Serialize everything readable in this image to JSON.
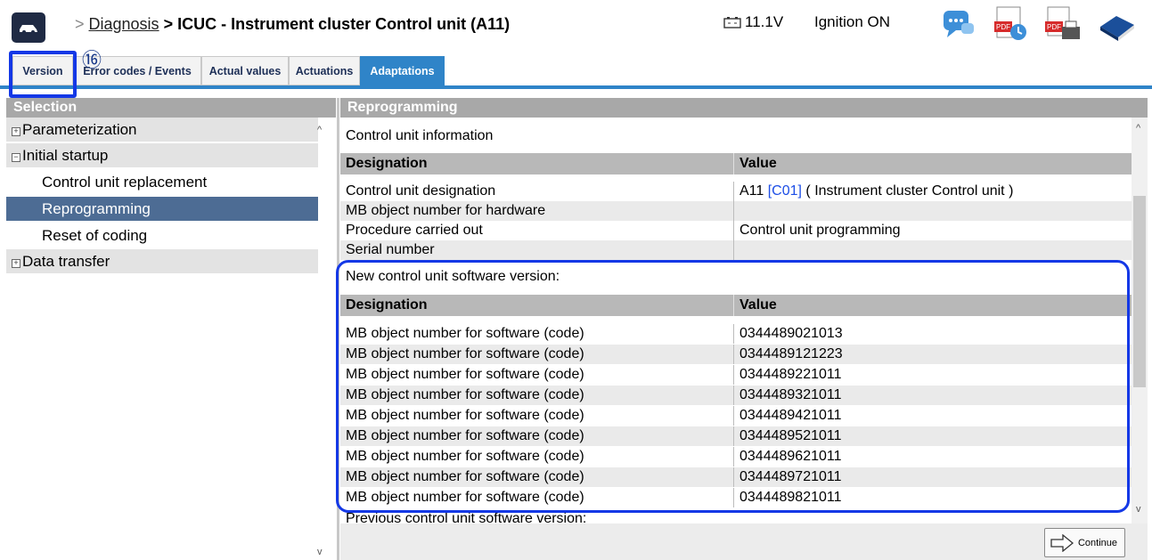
{
  "header": {
    "breadcrumb_sep": ">",
    "breadcrumb_link": "Diagnosis",
    "title": "> ICUC - Instrument cluster Control unit (A11)",
    "voltage": "11.1V",
    "ignition": "Ignition ON",
    "icons": [
      "car-icon",
      "chat-icon",
      "pdf-clock-icon",
      "pdf-print-icon",
      "book-icon"
    ]
  },
  "annotation": {
    "marker": "⑯"
  },
  "tabs": [
    {
      "label": "Version",
      "active": false
    },
    {
      "label": "Error codes / Events",
      "active": false
    },
    {
      "label": "Actual values",
      "active": false
    },
    {
      "label": "Actuations",
      "active": false
    },
    {
      "label": "Adaptations",
      "active": true
    }
  ],
  "left_panel": {
    "header": "Selection",
    "items": [
      {
        "label": "Parameterization",
        "expander": "+"
      },
      {
        "label": "Initial startup",
        "expander": "−"
      },
      {
        "label": "Control unit replacement"
      },
      {
        "label": "Reprogramming",
        "selected": true
      },
      {
        "label": "Reset of coding"
      },
      {
        "label": "Data transfer",
        "expander": "+"
      }
    ]
  },
  "right_panel": {
    "header": "Reprogramming",
    "info_section": "Control unit information",
    "col_designation": "Designation",
    "col_value": "Value",
    "info_rows": [
      {
        "designation": "Control unit designation",
        "value_prefix": "A11 ",
        "value_link": "[C01]",
        "value_suffix": " ( Instrument cluster Control unit )"
      },
      {
        "designation": "MB object number for hardware",
        "value": ""
      },
      {
        "designation": "Procedure carried out",
        "value": "Control unit programming"
      },
      {
        "designation": "Serial number",
        "value": ""
      }
    ],
    "new_section": "New control unit software version:",
    "software_rows": [
      {
        "designation": "MB object number for software (code)",
        "value": "0344489021013"
      },
      {
        "designation": "MB object number for software (code)",
        "value": "0344489121223"
      },
      {
        "designation": "MB object number for software (code)",
        "value": "0344489221011"
      },
      {
        "designation": "MB object number for software (code)",
        "value": "0344489321011"
      },
      {
        "designation": "MB object number for software (code)",
        "value": "0344489421011"
      },
      {
        "designation": "MB object number for software (code)",
        "value": "0344489521011"
      },
      {
        "designation": "MB object number for software (code)",
        "value": "0344489621011"
      },
      {
        "designation": "MB object number for software (code)",
        "value": "0344489721011"
      },
      {
        "designation": "MB object number for software (code)",
        "value": "0344489821011"
      }
    ],
    "previous_section": "Previous control unit software version:",
    "continue_label": "Continue"
  },
  "colors": {
    "tab_active": "#2f84c8",
    "selection": "#4d6c94",
    "highlight_box": "#1438e6",
    "link": "#1d4ee6"
  }
}
